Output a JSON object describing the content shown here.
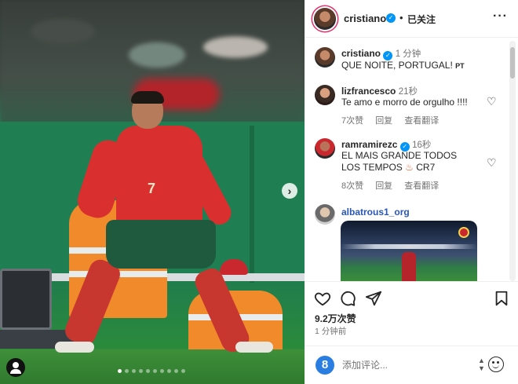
{
  "post": {
    "username": "cristiano",
    "follow_status": "已关注",
    "more_label": "···"
  },
  "caption": {
    "username": "cristiano",
    "time": "1 分钟",
    "text": "QUE NOITE, PORTUGAL!",
    "suffix": "PT"
  },
  "comments": [
    {
      "username": "lizfrancesco",
      "time": "21秒",
      "text": "Te amo e morro de orgulho !!!!",
      "likes": "7次赞",
      "reply": "回复",
      "translate": "查看翻译"
    },
    {
      "username": "ramramirezc",
      "time": "16秒",
      "text": "EL MAIS GRANDE TODOS LOS TEMPOS",
      "text_tail": "CR7",
      "emoji": "flame-emoji",
      "likes": "8次赞",
      "reply": "回复",
      "translate": "查看翻译"
    },
    {
      "username": "albatrous1_org"
    }
  ],
  "stats": {
    "likes": "9.2万次赞",
    "posted": "1 分钟前"
  },
  "composer": {
    "placeholder": "添加评论...",
    "logo_glyph": "8"
  },
  "photo": {
    "jersey_number": "7"
  },
  "icons": {
    "heart": "heart-icon",
    "comment": "comment-icon",
    "share": "share-icon",
    "save": "bookmark-icon",
    "next": "chevron-right-icon",
    "tag": "user-tag-icon",
    "emoji": "emoji-icon"
  },
  "colors": {
    "verified": "#0095f6",
    "story_ring": "#e1306c",
    "muted_text": "#737373"
  }
}
